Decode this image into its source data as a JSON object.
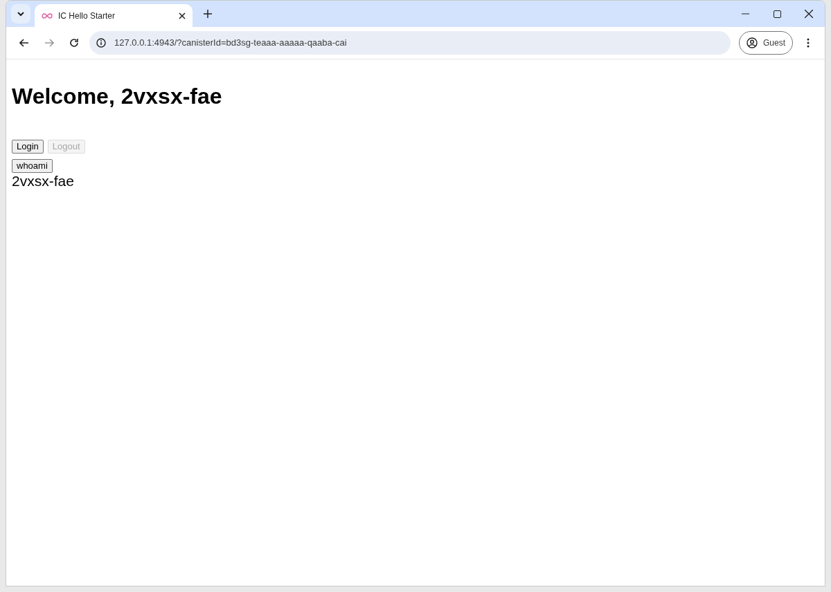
{
  "browser": {
    "tabs": [
      {
        "title": "IC Hello Starter",
        "selected": true
      }
    ],
    "url": "127.0.0.1:4943/?canisterId=bd3sg-teaaa-aaaaa-qaaba-cai",
    "profile": "Guest"
  },
  "page": {
    "heading": "Welcome, 2vxsx-fae",
    "auth_buttons": [
      {
        "label": "Login",
        "disabled": false
      },
      {
        "label": "Logout",
        "disabled": true
      }
    ],
    "whoami_button": {
      "label": "whoami",
      "disabled": false
    },
    "output": "2vxsx-fae"
  }
}
